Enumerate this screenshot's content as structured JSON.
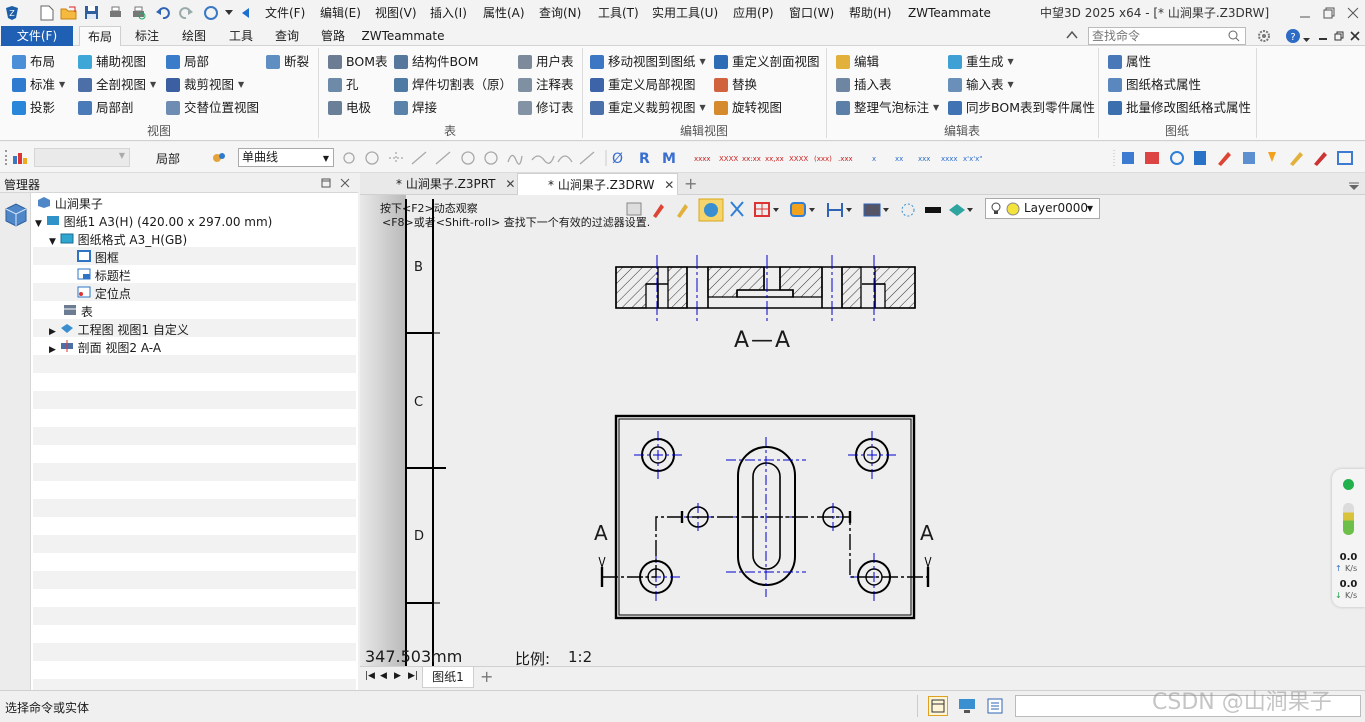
{
  "title_bar": {
    "menus": [
      "文件(F)",
      "编辑(E)",
      "视图(V)",
      "插入(I)",
      "属性(A)",
      "查询(N)",
      "工具(T)",
      "实用工具(U)",
      "应用(P)",
      "窗口(W)",
      "帮助(H)",
      "ZWTeammate"
    ],
    "window_title": "中望3D 2025 x64 - [* 山涧果子.Z3DRW]"
  },
  "ribbon_tabs": {
    "file": "文件(F)",
    "tabs": [
      "布局",
      "标注",
      "绘图",
      "工具",
      "查询",
      "管路",
      "ZWTeammate"
    ],
    "active": "布局",
    "search_placeholder": "查找命令"
  },
  "ribbon": {
    "view": {
      "label": "视图",
      "buttons": [
        "布局",
        "辅助视图",
        "局部",
        "断裂",
        "标准",
        "全剖视图",
        "裁剪视图",
        "投影",
        "局部剖",
        "交替位置视图"
      ]
    },
    "table": {
      "label": "表",
      "buttons": [
        "BOM表",
        "结构件BOM",
        "用户表",
        "孔",
        "焊件切割表（原）",
        "注释表",
        "电极",
        "焊接",
        "修订表"
      ]
    },
    "edit_view": {
      "label": "编辑视图",
      "buttons": [
        "移动视图到图纸",
        "重定义剖面视图",
        "重定义局部视图",
        "替换",
        "重定义裁剪视图",
        "旋转视图"
      ]
    },
    "edit_table": {
      "label": "编辑表",
      "buttons": [
        "编辑",
        "重生成",
        "插入表",
        "输入表",
        "整理气泡标注",
        "同步BOM表到零件属性"
      ]
    },
    "sheet": {
      "label": "图纸",
      "buttons": [
        "属性",
        "图纸格式属性",
        "批量修改图纸格式属性"
      ]
    }
  },
  "toolbar2": {
    "layer_combo": "",
    "scope_label": "局部",
    "curve_type": "单曲线"
  },
  "manager": {
    "title": "管理器",
    "tree": [
      {
        "label": "山涧果子",
        "icon": "part-icon"
      },
      {
        "label": "图纸1 A3(H) (420.00 x 297.00 mm)",
        "icon": "sheet-icon"
      },
      {
        "label": "图纸格式 A3_H(GB)",
        "icon": "format-icon"
      },
      {
        "label": "图框",
        "icon": "frame-icon"
      },
      {
        "label": "标题栏",
        "icon": "titleblock-icon"
      },
      {
        "label": "定位点",
        "icon": "anchor-icon"
      },
      {
        "label": "表",
        "icon": "table-icon"
      },
      {
        "label": "工程图 视图1 自定义",
        "icon": "drawing-view-icon"
      },
      {
        "label": "剖面 视图2 A-A",
        "icon": "section-view-icon"
      }
    ]
  },
  "doc_tabs": [
    "* 山涧果子.Z3PRT",
    "* 山涧果子.Z3DRW"
  ],
  "canvas": {
    "hint1": "按下<F2>动态观察",
    "hint2": "<F8>或者<Shift-roll> 查找下一个有效的过滤器设置.",
    "layer": "Layer0000",
    "zone_labels": [
      "B",
      "C",
      "D"
    ],
    "section_caption": "A—A",
    "section_marker": "A",
    "distance": "347.503mm",
    "scale_label": "比例:",
    "scale_value": "1:2"
  },
  "sheet_tab": "图纸1",
  "status": {
    "prompt": "选择命令或实体",
    "watermark": "CSDN @山涧果子"
  },
  "side_widget": {
    "up_value": "0.0",
    "up_unit": "K/s",
    "down_value": "0.0",
    "down_unit": "K/s"
  },
  "colors": {
    "accent_blue": "#1f5fb4",
    "centerline": "#0000cc",
    "hatch": "#000000"
  }
}
